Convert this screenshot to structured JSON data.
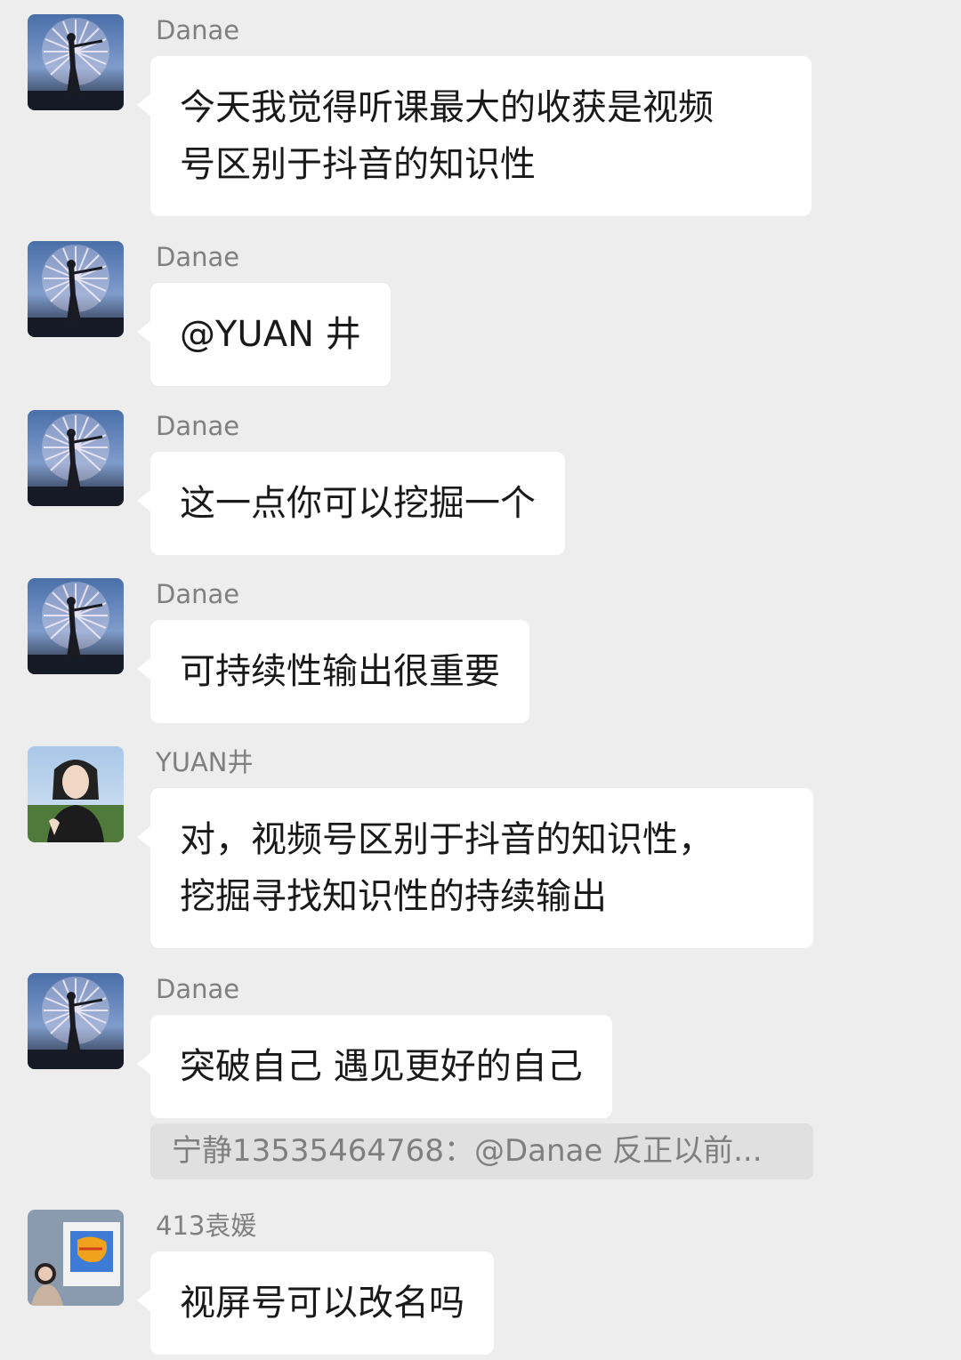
{
  "messages": [
    {
      "sender": "Danae",
      "avatar": "fireworks-avatar",
      "lines": [
        "今天我觉得听课最大的收获是视频",
        "号区别于抖音的知识性"
      ]
    },
    {
      "sender": "Danae",
      "avatar": "fireworks-avatar",
      "lines": [
        "@YUAN 井"
      ]
    },
    {
      "sender": "Danae",
      "avatar": "fireworks-avatar",
      "lines": [
        "这一点你可以挖掘一个"
      ]
    },
    {
      "sender": "Danae",
      "avatar": "fireworks-avatar",
      "lines": [
        "可持续性输出很重要"
      ]
    },
    {
      "sender": "YUAN井",
      "avatar": "woman-portrait-avatar",
      "lines": [
        "对，视频号区别于抖音的知识性，",
        "挖掘寻找知识性的持续输出"
      ]
    },
    {
      "sender": "Danae",
      "avatar": "fireworks-avatar",
      "lines": [
        "突破自己 遇见更好的自己"
      ]
    },
    {
      "sender": "413袁媛",
      "avatar": "child-painting-avatar",
      "lines": [
        "视屏号可以改名吗"
      ]
    }
  ],
  "quote": {
    "text": "宁静13535464768：@Danae 反正以前..."
  },
  "colors": {
    "background": "#ededed",
    "bubble": "#ffffff",
    "sender_text": "#7f7f7f",
    "message_text": "#191919",
    "quote_bg": "#e0e0e0"
  }
}
